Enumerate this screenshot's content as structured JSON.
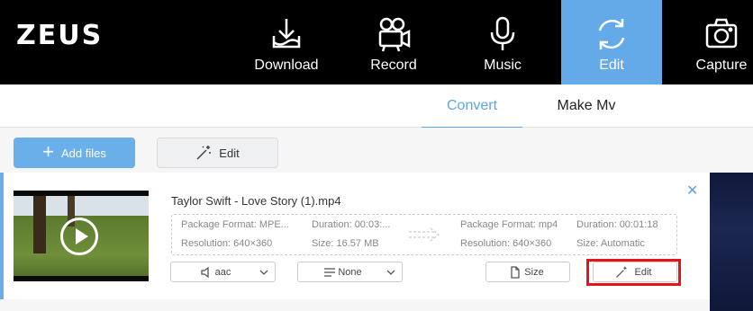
{
  "app": {
    "logo": "ZEUS"
  },
  "nav": {
    "items": [
      {
        "label": "Download",
        "icon": "download-icon"
      },
      {
        "label": "Record",
        "icon": "video-camera-icon"
      },
      {
        "label": "Music",
        "icon": "microphone-icon"
      },
      {
        "label": "Edit",
        "icon": "refresh-icon",
        "active": true
      },
      {
        "label": "Capture",
        "icon": "camera-icon"
      }
    ],
    "active_color": "#64aae8"
  },
  "subtabs": {
    "convert": "Convert",
    "make_mv": "Make Mv"
  },
  "toolbar": {
    "add_files": "Add files",
    "edit": "Edit"
  },
  "file": {
    "name": "Taylor Swift - Love Story (1).mp4",
    "source": {
      "format": "Package Format: MPE...",
      "duration": "Duration:  00:03:...",
      "resolution": "Resolution: 640×360",
      "size": "Size: 16.57 MB"
    },
    "target": {
      "format": "Package Format: mp4",
      "duration": "Duration:  00:01:18",
      "resolution": "Resolution: 640×360",
      "size": "Size: Automatic"
    },
    "audio": "aac",
    "subtitle": "None",
    "size_button": "Size",
    "edit_button": "Edit"
  },
  "colors": {
    "accent": "#5aa5e6",
    "highlight": "#e8121b"
  }
}
